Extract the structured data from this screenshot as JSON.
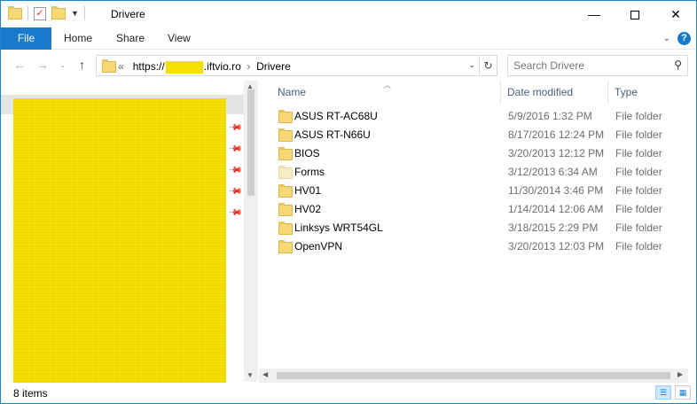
{
  "window": {
    "title": "Drivere",
    "controls": {
      "minimize": "—",
      "maximize": "",
      "close": "✕"
    }
  },
  "ribbon": {
    "file_label": "File",
    "tabs": [
      "Home",
      "Share",
      "View"
    ],
    "help": "?"
  },
  "address": {
    "prefix": "«",
    "scheme": "https://",
    "host_suffix": ".iftvio.ro",
    "separator": "›",
    "current": "Drivere"
  },
  "search": {
    "placeholder": "Search Drivere"
  },
  "columns": {
    "name": "Name",
    "date": "Date modified",
    "type": "Type"
  },
  "files": [
    {
      "name": "ASUS RT-AC68U",
      "date": "5/9/2016 1:32 PM",
      "type": "File folder"
    },
    {
      "name": "ASUS RT-N66U",
      "date": "8/17/2016 12:24 PM",
      "type": "File folder"
    },
    {
      "name": "BIOS",
      "date": "3/20/2013 12:12 PM",
      "type": "File folder"
    },
    {
      "name": "Forms",
      "date": "3/12/2013 6:34 AM",
      "type": "File folder"
    },
    {
      "name": "HV01",
      "date": "11/30/2014 3:46 PM",
      "type": "File folder"
    },
    {
      "name": "HV02",
      "date": "1/14/2014 12:06 AM",
      "type": "File folder"
    },
    {
      "name": "Linksys WRT54GL",
      "date": "3/18/2015 2:29 PM",
      "type": "File folder"
    },
    {
      "name": "OpenVPN",
      "date": "3/20/2013 12:03 PM",
      "type": "File folder"
    }
  ],
  "status": {
    "items": "8 items"
  },
  "colors": {
    "accent": "#1979ca",
    "redaction": "#f5e000",
    "folder": "#f8d775"
  }
}
